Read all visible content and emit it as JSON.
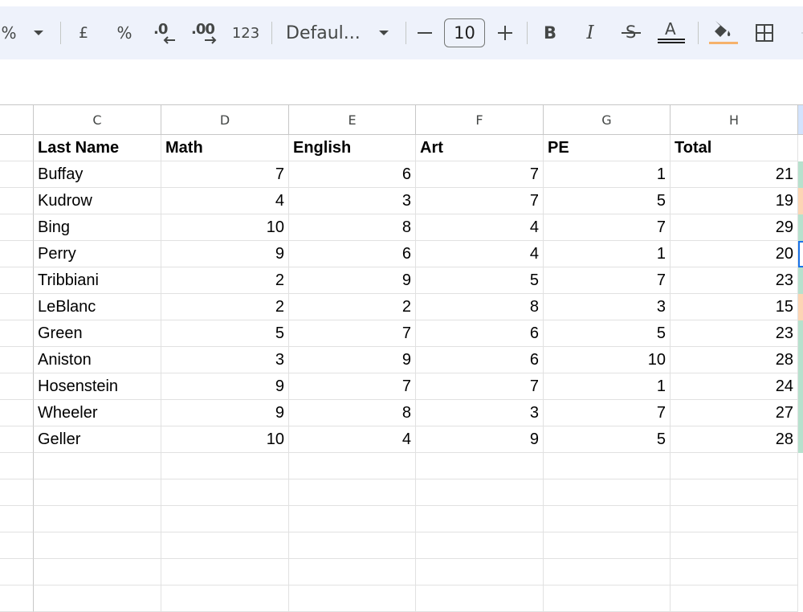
{
  "toolbar": {
    "percent_partial": "%",
    "currency": "£",
    "percent": "%",
    "decrease_decimal": ".0",
    "increase_decimal": ".00",
    "more_formats": "123",
    "font_name": "Defaul...",
    "font_size": "10",
    "minus": "—",
    "plus": "+",
    "bold": "B",
    "italic": "I",
    "strike": "S",
    "text_color": "A"
  },
  "columns": [
    "C",
    "D",
    "E",
    "F",
    "G",
    "H"
  ],
  "headers": [
    "Last Name",
    "Math",
    "English",
    "Art",
    "PE",
    "Total"
  ],
  "rows": [
    {
      "cells": [
        "Buffay",
        "7",
        "6",
        "7",
        "1",
        "21"
      ],
      "edge": "#b7e1cd"
    },
    {
      "cells": [
        "Kudrow",
        "4",
        "3",
        "7",
        "5",
        "19"
      ],
      "edge": "#fcd5b4"
    },
    {
      "cells": [
        "Bing",
        "10",
        "8",
        "4",
        "7",
        "29"
      ],
      "edge": "#b7e1cd"
    },
    {
      "cells": [
        "Perry",
        "9",
        "6",
        "4",
        "1",
        "20"
      ],
      "edge": "#1a73e8"
    },
    {
      "cells": [
        "Tribbiani",
        "2",
        "9",
        "5",
        "7",
        "23"
      ],
      "edge": "#b7e1cd"
    },
    {
      "cells": [
        "LeBlanc",
        "2",
        "2",
        "8",
        "3",
        "15"
      ],
      "edge": "#fcd5b4"
    },
    {
      "cells": [
        "Green",
        "5",
        "7",
        "6",
        "5",
        "23"
      ],
      "edge": "#b7e1cd"
    },
    {
      "cells": [
        "Aniston",
        "3",
        "9",
        "6",
        "10",
        "28"
      ],
      "edge": "#b7e1cd"
    },
    {
      "cells": [
        "Hosenstein",
        "9",
        "7",
        "7",
        "1",
        "24"
      ],
      "edge": "#b7e1cd"
    },
    {
      "cells": [
        "Wheeler",
        "9",
        "8",
        "3",
        "7",
        "27"
      ],
      "edge": "#b7e1cd"
    },
    {
      "cells": [
        "Geller",
        "10",
        "4",
        "9",
        "5",
        "28"
      ],
      "edge": "#b7e1cd"
    }
  ],
  "empty_rows": 6,
  "colors": {
    "toolbar_bg": "#eef2fb",
    "fill_underline": "#f6b26b",
    "selection": "#1a73e8"
  }
}
